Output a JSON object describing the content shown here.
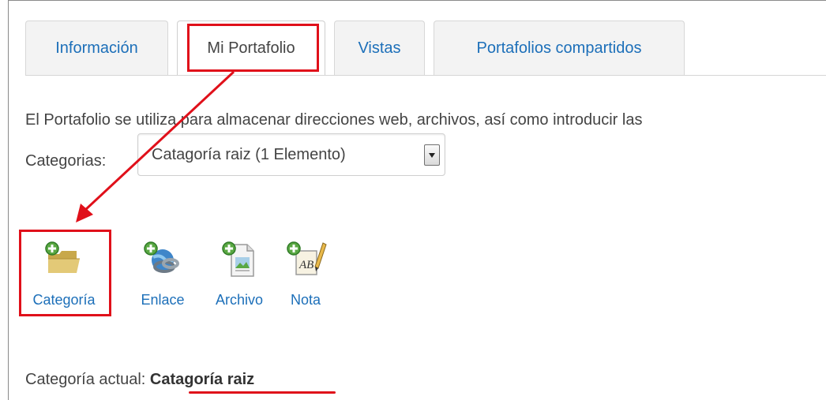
{
  "tabs": {
    "info": "Información",
    "mine": "Mi Portafolio",
    "views": "Vistas",
    "shared": "Portafolios compartidos"
  },
  "description": "El Portafolio se utiliza para almacenar direcciones web, archivos, así como introducir las",
  "categories": {
    "label": "Categorias:",
    "selected": "Catagoría raiz (1 Elemento)"
  },
  "toolbar": {
    "category": "Categoría",
    "link": "Enlace",
    "file": "Archivo",
    "note": "Nota"
  },
  "current": {
    "label": "Categoría actual:",
    "value": "Catagoría raiz"
  },
  "colors": {
    "link": "#1c6fb9",
    "highlight": "#e0101a",
    "text": "#444444"
  },
  "icons": [
    "add-folder-icon",
    "add-link-icon",
    "add-file-icon",
    "add-note-icon",
    "dropdown-arrow-icon"
  ]
}
